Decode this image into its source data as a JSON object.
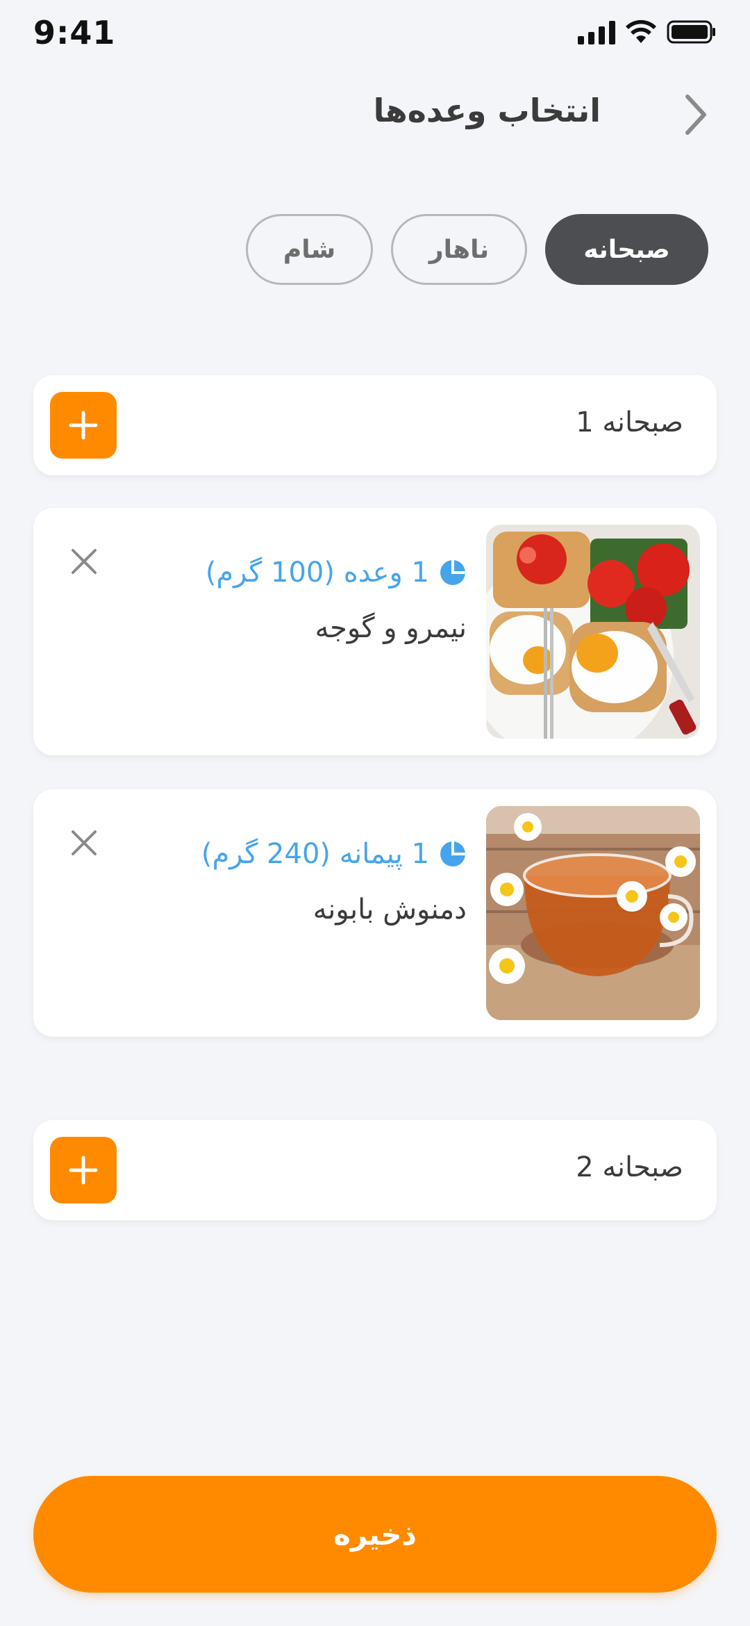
{
  "status_bar": {
    "time": "9:41"
  },
  "header": {
    "title": "انتخاب وعده‌ها"
  },
  "tabs": [
    {
      "label": "صبحانه",
      "active": true
    },
    {
      "label": "ناهار",
      "active": false
    },
    {
      "label": "شام",
      "active": false
    }
  ],
  "meals": [
    {
      "title": "صبحانه 1",
      "items": [
        {
          "name": "نیمرو و گوجه",
          "portion": "1 وعده (100 گرم)",
          "image": "fried-eggs-tomato-toast"
        },
        {
          "name": "دمنوش بابونه",
          "portion": "1 پیمانه (240 گرم)",
          "image": "chamomile-tea-cup"
        }
      ]
    },
    {
      "title": "صبحانه 2",
      "items": []
    }
  ],
  "save_label": "ذخیره",
  "colors": {
    "accent": "#ff8a00",
    "portion": "#46a5ea",
    "tab_active": "#4d4e51",
    "background": "#f4f5f8"
  }
}
